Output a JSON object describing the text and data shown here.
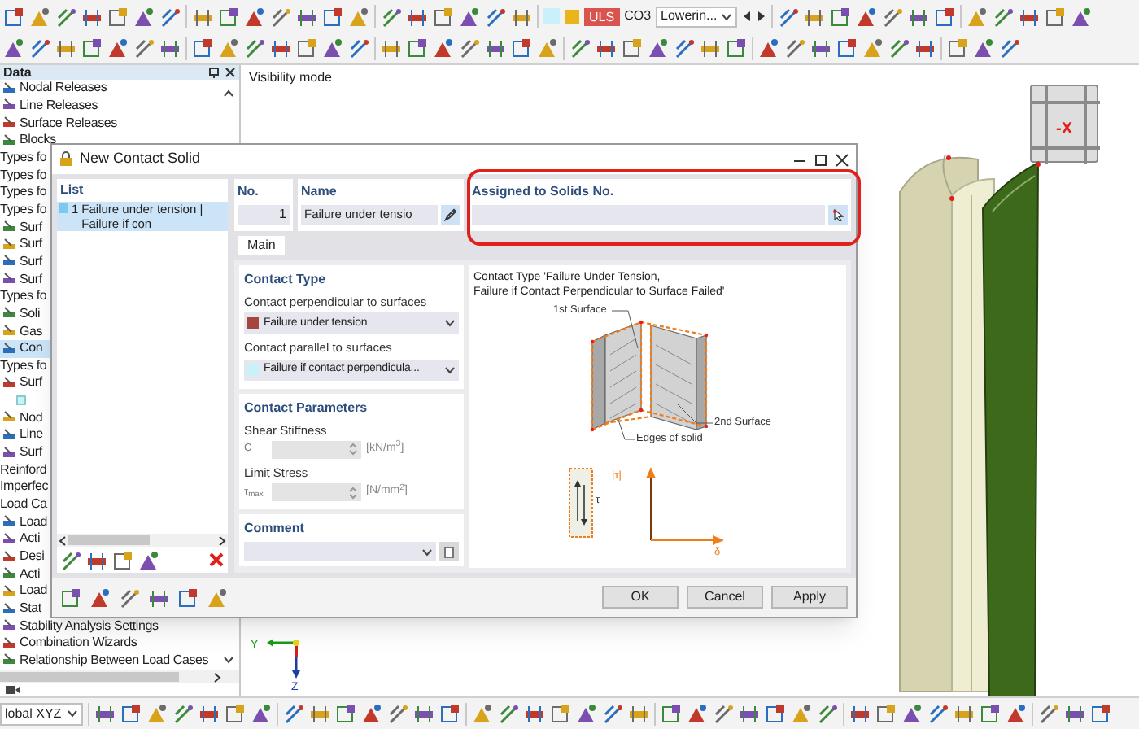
{
  "toolbar": {
    "load_type": "ULS",
    "combination": "CO3",
    "load_case": "Lowerin..."
  },
  "navigator": {
    "title": "Data",
    "items": [
      {
        "kind": "item",
        "label": "Nodal Releases",
        "selected": false
      },
      {
        "kind": "item",
        "label": "Line Releases",
        "selected": false
      },
      {
        "kind": "item",
        "label": "Surface Releases",
        "selected": false
      },
      {
        "kind": "item",
        "label": "Blocks",
        "selected": false
      },
      {
        "kind": "group",
        "label": "Types fo",
        "selected": false
      },
      {
        "kind": "group",
        "label": "Types fo",
        "selected": false
      },
      {
        "kind": "group",
        "label": "Types fo",
        "selected": false
      },
      {
        "kind": "group",
        "label": "Types fo",
        "selected": false
      },
      {
        "kind": "item",
        "label": "Surf",
        "selected": false
      },
      {
        "kind": "item",
        "label": "Surf",
        "selected": false
      },
      {
        "kind": "item",
        "label": "Surf",
        "selected": false
      },
      {
        "kind": "item",
        "label": "Surf",
        "selected": false
      },
      {
        "kind": "group",
        "label": "Types fo",
        "selected": false
      },
      {
        "kind": "item",
        "label": "Soli",
        "selected": false
      },
      {
        "kind": "item",
        "label": "Gas",
        "selected": false
      },
      {
        "kind": "item",
        "label": "Con",
        "selected": true
      },
      {
        "kind": "group",
        "label": "Types fo",
        "selected": false
      },
      {
        "kind": "item",
        "label": "Surf",
        "selected": false
      },
      {
        "kind": "swatch",
        "selected": false
      },
      {
        "kind": "item",
        "label": "Nod",
        "selected": false
      },
      {
        "kind": "item",
        "label": "Line",
        "selected": false
      },
      {
        "kind": "item",
        "label": "Surf",
        "selected": false
      },
      {
        "kind": "group",
        "label": "Reinford",
        "selected": false
      },
      {
        "kind": "group",
        "label": "Imperfec",
        "selected": false
      },
      {
        "kind": "group",
        "label": "Load Ca",
        "selected": false
      },
      {
        "kind": "item",
        "label": "Load",
        "selected": false
      },
      {
        "kind": "item",
        "label": "Acti",
        "selected": false
      },
      {
        "kind": "item",
        "label": "Desi",
        "selected": false
      },
      {
        "kind": "item",
        "label": "Acti",
        "selected": false
      },
      {
        "kind": "item",
        "label": "Load",
        "selected": false
      },
      {
        "kind": "item",
        "label": "Stat",
        "selected": false
      },
      {
        "kind": "item",
        "label": "Stability Analysis Settings",
        "selected": false
      },
      {
        "kind": "item",
        "label": "Combination Wizards",
        "selected": false
      },
      {
        "kind": "item",
        "label": "Relationship Between Load Cases",
        "selected": false
      }
    ]
  },
  "viewport": {
    "mode": "Visibility mode",
    "view_cube": "-X",
    "axes": [
      "Y",
      "Z"
    ]
  },
  "dialog": {
    "title": "New Contact Solid",
    "list": {
      "header": "List",
      "items": [
        {
          "number": "1",
          "label": "Failure under tension | Failure if con",
          "selected": true
        }
      ]
    },
    "number": {
      "label": "No.",
      "value": "1"
    },
    "name": {
      "label": "Name",
      "value": "Failure under tensio"
    },
    "assigned": {
      "label": "Assigned to Solids No."
    },
    "tabs": [
      {
        "label": "Main",
        "selected": true
      }
    ],
    "contact_type": {
      "title": "Contact Type",
      "fields": [
        {
          "label": "Contact perpendicular to surfaces",
          "value": "Failure under tension",
          "color": "#a5463e"
        },
        {
          "label": "Contact parallel to surfaces",
          "value": "Failure if contact perpendicula...",
          "color": "#c9f1fb"
        }
      ]
    },
    "contact_parameters": {
      "title": "Contact Parameters",
      "fields": [
        {
          "label": "Shear Stiffness",
          "symbol": "C",
          "unit": "[kN/m$^{3}$]",
          "disabled": true
        },
        {
          "label": "Limit Stress",
          "symbol": "τ$_{max}$",
          "unit": "[N/mm$^{2}$]",
          "disabled": true
        }
      ]
    },
    "comment": {
      "label": "Comment"
    },
    "figure": {
      "caption": [
        "Contact Type 'Failure Under Tension,",
        "Failure if Contact Perpendicular to Surface Failed'"
      ],
      "labels": {
        "first_surface": "1st Surface",
        "second_surface": "2nd Surface",
        "edges": "Edges of solid",
        "element": "τ",
        "stress": "|τ|",
        "axis": "δ"
      }
    },
    "buttons": [
      "OK",
      "Cancel",
      "Apply"
    ]
  },
  "bottom_toolbar": {
    "coordinate_system": "lobal XYZ"
  }
}
